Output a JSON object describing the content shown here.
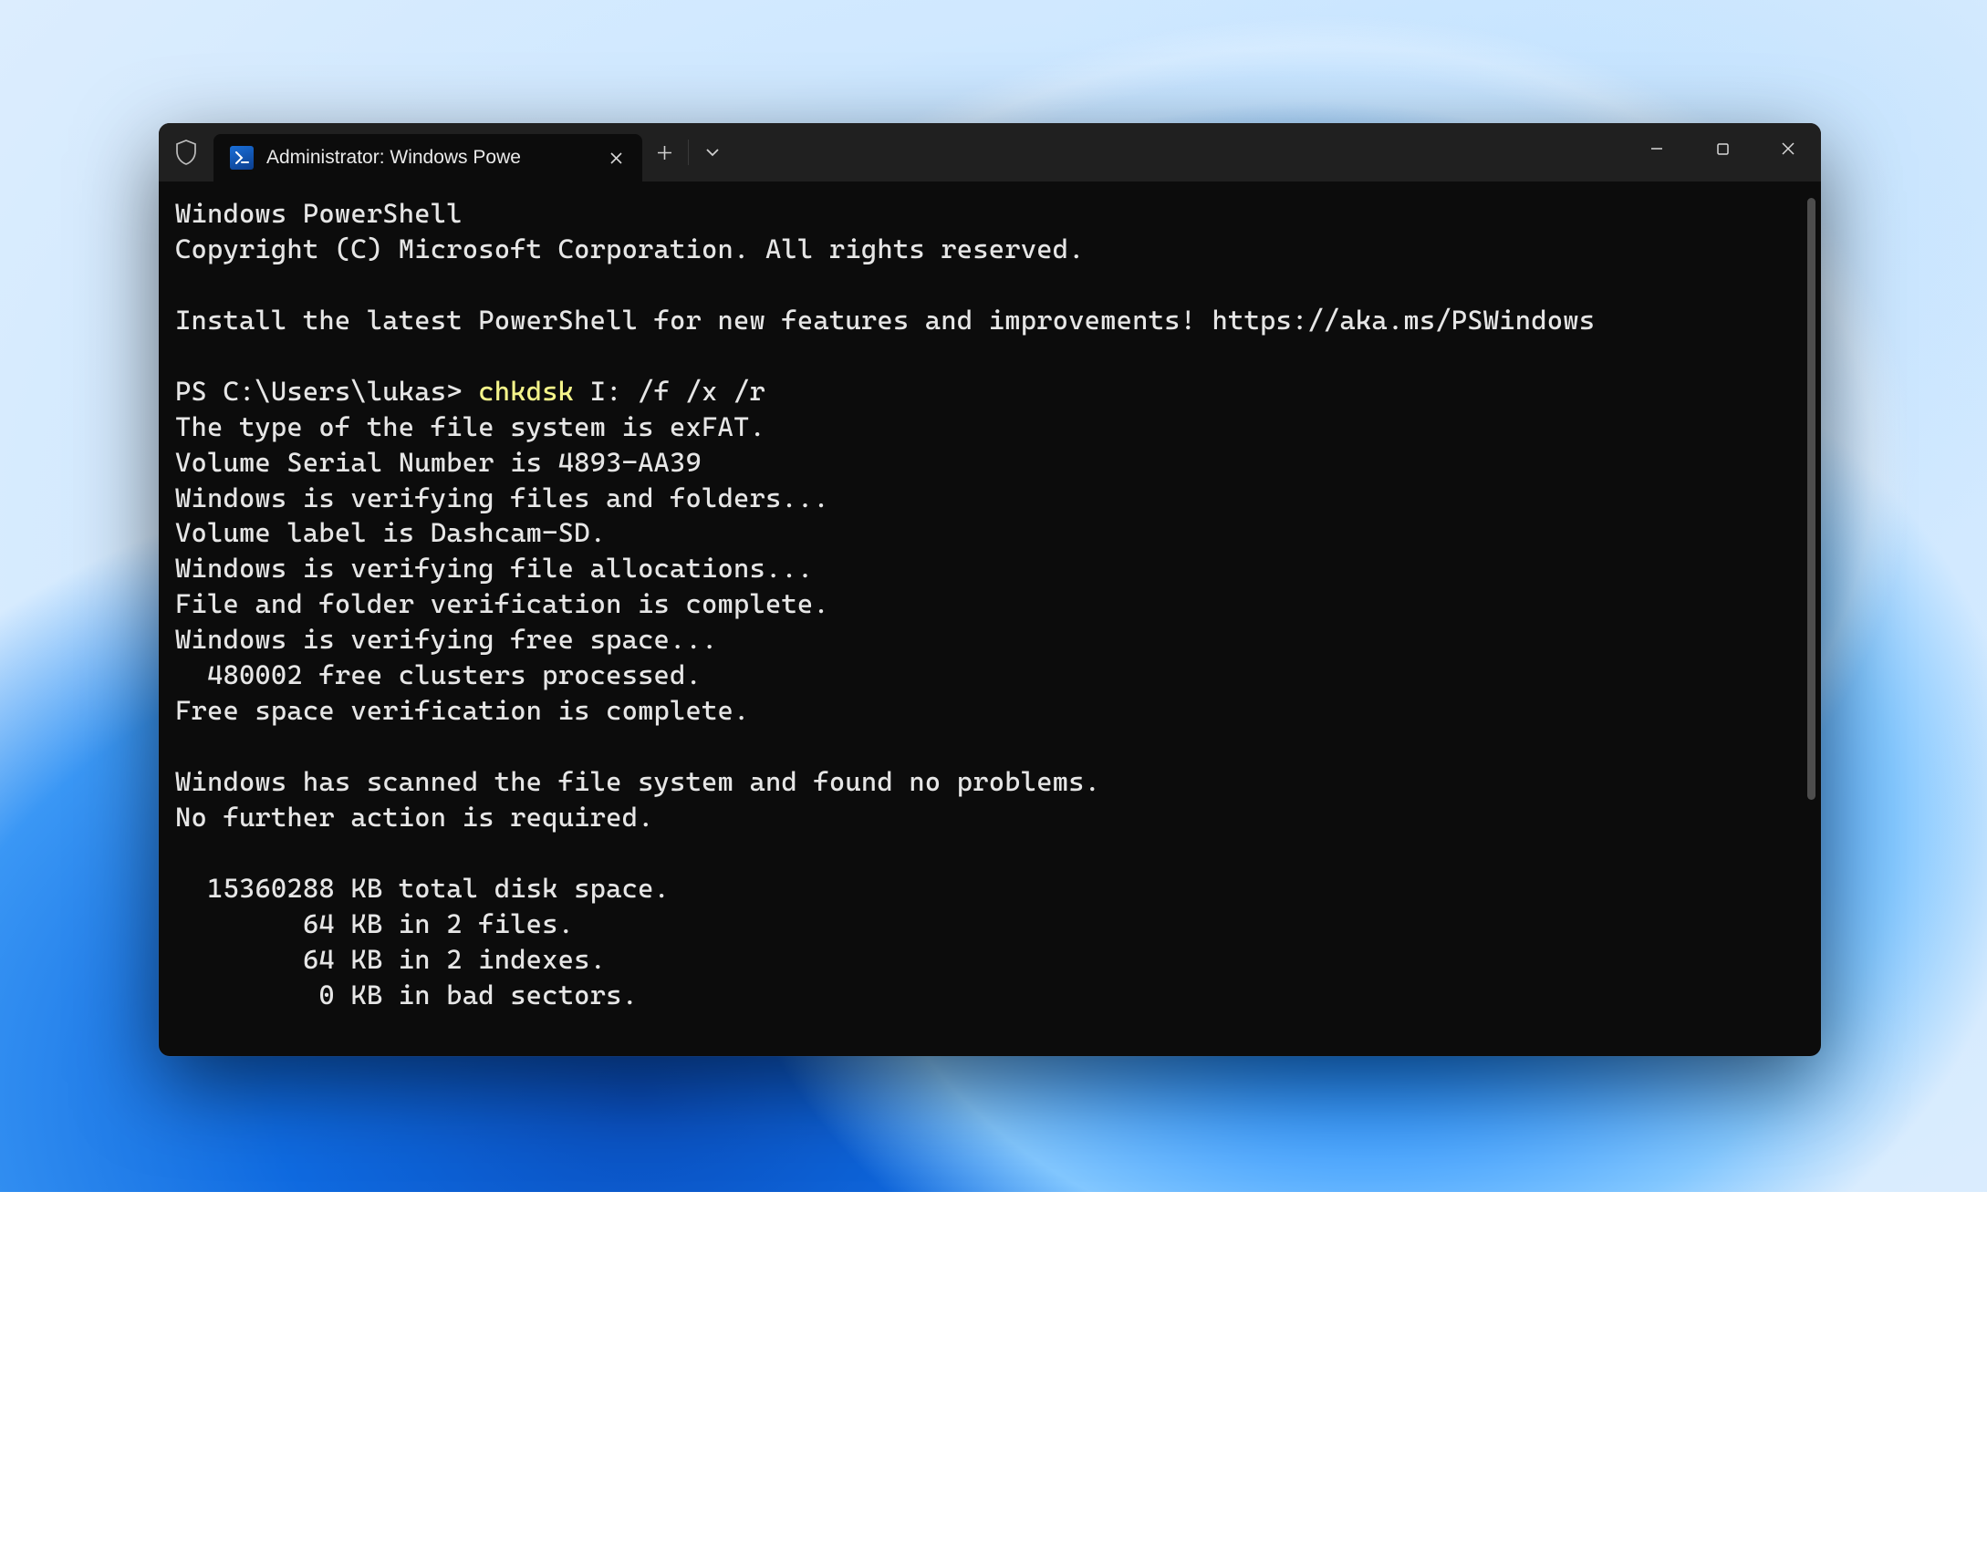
{
  "tab": {
    "title": "Administrator: Windows Powe"
  },
  "terminal": {
    "header1": "Windows PowerShell",
    "header2": "Copyright (C) Microsoft Corporation. All rights reserved.",
    "install_notice": "Install the latest PowerShell for new features and improvements! https://aka.ms/PSWindows",
    "prompt": "PS C:\\Users\\lukas> ",
    "command_highlight": "chkdsk",
    "command_rest": " I: /f /x /r",
    "lines": {
      "l1": "The type of the file system is exFAT.",
      "l2": "Volume Serial Number is 4893-AA39",
      "l3": "Windows is verifying files and folders...",
      "l4": "Volume label is Dashcam-SD.",
      "l5": "Windows is verifying file allocations...",
      "l6": "File and folder verification is complete.",
      "l7": "Windows is verifying free space...",
      "l8": "  480002 free clusters processed.",
      "l9": "Free space verification is complete.",
      "l10": "",
      "l11": "Windows has scanned the file system and found no problems.",
      "l12": "No further action is required.",
      "l13": "",
      "l14": "  15360288 KB total disk space.",
      "l15": "        64 KB in 2 files.",
      "l16": "        64 KB in 2 indexes.",
      "l17": "         0 KB in bad sectors."
    }
  }
}
